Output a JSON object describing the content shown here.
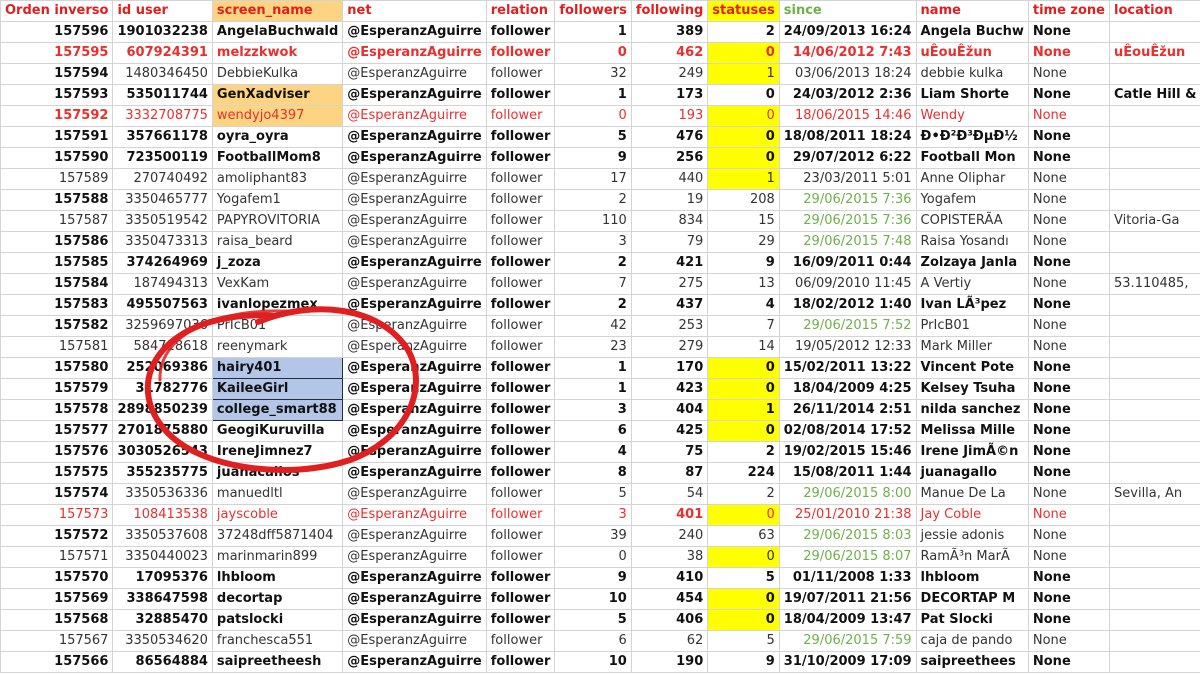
{
  "columns": [
    "Orden inverso",
    "id user",
    "screen_name",
    "net",
    "relation",
    "followers",
    "following",
    "statuses",
    "since",
    "name",
    "time zone",
    "location"
  ],
  "rows": [
    {
      "orden": "157596",
      "id": "1901032238",
      "screen": "AngelaBuchwald",
      "net": "@EsperanzAguirre",
      "rel": "follower",
      "followers": "1",
      "following": "389",
      "statuses": "2",
      "since": "24/09/2013 16:24",
      "name": "Angela Buchw",
      "tz": "None",
      "loc": "",
      "style": "bold"
    },
    {
      "orden": "157595",
      "id": "607924391",
      "screen": "melzzkwok",
      "net": "@EsperanzAguirre",
      "rel": "follower",
      "followers": "0",
      "following": "462",
      "statuses": "0",
      "since": "14/06/2012 7:43",
      "name": "uÊouÊžun",
      "tz": "None",
      "loc": "uÊouÊžun",
      "style": "redbold",
      "statusFill": "yellow"
    },
    {
      "orden": "157594",
      "id": "1480346450",
      "screen": "DebbieKulka",
      "net": "@EsperanzAguirre",
      "rel": "follower",
      "followers": "32",
      "following": "249",
      "statuses": "1",
      "since": "03/06/2013 18:24",
      "name": "debbie kulka",
      "tz": "None",
      "loc": "",
      "style": "normal",
      "statusFill": "yellow",
      "orderBold": true
    },
    {
      "orden": "157593",
      "id": "535011744",
      "screen": "GenXadviser",
      "net": "@EsperanzAguirre",
      "rel": "follower",
      "followers": "1",
      "following": "173",
      "statuses": "0",
      "since": "24/03/2012 2:36",
      "name": "Liam Shorte",
      "tz": "None",
      "loc": "Catle Hill &",
      "style": "bold",
      "screenFill": "orange"
    },
    {
      "orden": "157592",
      "id": "3332708775",
      "screen": "wendyjo4397",
      "net": "@EsperanzAguirre",
      "rel": "follower",
      "followers": "0",
      "following": "193",
      "statuses": "0",
      "since": "18/06/2015 14:46",
      "name": "Wendy",
      "tz": "None",
      "loc": "",
      "style": "red",
      "screenFill": "orange",
      "statusFill": "yellow",
      "orderBold": true
    },
    {
      "orden": "157591",
      "id": "357661178",
      "screen": "oyra_oyra",
      "net": "@EsperanzAguirre",
      "rel": "follower",
      "followers": "5",
      "following": "476",
      "statuses": "0",
      "since": "18/08/2011 18:24",
      "name": "Đ•Đ²Đ³ĐµĐ½",
      "tz": "None",
      "loc": "",
      "style": "bold",
      "statusFill": "yellow"
    },
    {
      "orden": "157590",
      "id": "723500119",
      "screen": "FootballMom8",
      "net": "@EsperanzAguirre",
      "rel": "follower",
      "followers": "9",
      "following": "256",
      "statuses": "0",
      "since": "29/07/2012 6:22",
      "name": "Football Mon",
      "tz": "None",
      "loc": "",
      "style": "bold",
      "statusFill": "yellow"
    },
    {
      "orden": "157589",
      "id": "270740492",
      "screen": "amoliphant83",
      "net": "@EsperanzAguirre",
      "rel": "follower",
      "followers": "17",
      "following": "440",
      "statuses": "1",
      "since": "23/03/2011 5:01",
      "name": "Anne Oliphar",
      "tz": "None",
      "loc": "",
      "style": "normal",
      "statusFill": "yellow"
    },
    {
      "orden": "157588",
      "id": "3350465777",
      "screen": "Yogafem1",
      "net": "@EsperanzAguirre",
      "rel": "follower",
      "followers": "2",
      "following": "19",
      "statuses": "208",
      "since": "29/06/2015 7:36",
      "name": "Yogafem",
      "tz": "None",
      "loc": "",
      "style": "normal",
      "sinceGreen": true,
      "orderBold": true
    },
    {
      "orden": "157587",
      "id": "3350519542",
      "screen": "PAPYROVITORIA",
      "net": "@EsperanzAguirre",
      "rel": "follower",
      "followers": "110",
      "following": "834",
      "statuses": "15",
      "since": "29/06/2015 7:36",
      "name": "COPISTERÃA",
      "tz": "None",
      "loc": "Vitoria-Ga",
      "style": "normal",
      "sinceGreen": true
    },
    {
      "orden": "157586",
      "id": "3350473313",
      "screen": "raisa_beard",
      "net": "@EsperanzAguirre",
      "rel": "follower",
      "followers": "3",
      "following": "79",
      "statuses": "29",
      "since": "29/06/2015 7:48",
      "name": "Raisa Yosandı",
      "tz": "None",
      "loc": "",
      "style": "normal",
      "sinceGreen": true,
      "orderBold": true
    },
    {
      "orden": "157585",
      "id": "374264969",
      "screen": "j_zoza",
      "net": "@EsperanzAguirre",
      "rel": "follower",
      "followers": "2",
      "following": "421",
      "statuses": "9",
      "since": "16/09/2011 0:44",
      "name": "Zolzaya Janla",
      "tz": "None",
      "loc": "",
      "style": "bold"
    },
    {
      "orden": "157584",
      "id": "187494313",
      "screen": "VexKam",
      "net": "@EsperanzAguirre",
      "rel": "follower",
      "followers": "7",
      "following": "275",
      "statuses": "13",
      "since": "06/09/2010 11:45",
      "name": "A Vertiy",
      "tz": "None",
      "loc": "53.110485,",
      "style": "normal",
      "orderBold": true
    },
    {
      "orden": "157583",
      "id": "495507563",
      "screen": "ivanlopezmex",
      "net": "@EsperanzAguirre",
      "rel": "follower",
      "followers": "2",
      "following": "437",
      "statuses": "4",
      "since": "18/02/2012 1:40",
      "name": "Ivan LÃ³pez",
      "tz": "None",
      "loc": "",
      "style": "bold"
    },
    {
      "orden": "157582",
      "id": "3259697036",
      "screen": "PrIcB01",
      "net": "@EsperanzAguirre",
      "rel": "follower",
      "followers": "42",
      "following": "253",
      "statuses": "7",
      "since": "29/06/2015 7:52",
      "name": "PrIcB01",
      "tz": "None",
      "loc": "",
      "style": "normal",
      "sinceGreen": true,
      "orderBold": true
    },
    {
      "orden": "157581",
      "id": "584718618",
      "screen": "reenymark",
      "net": "@EsperanzAguirre",
      "rel": "follower",
      "followers": "23",
      "following": "279",
      "statuses": "14",
      "since": "19/05/2012 12:33",
      "name": "Mark Miller",
      "tz": "None",
      "loc": "",
      "style": "normal"
    },
    {
      "orden": "157580",
      "id": "252069386",
      "screen": "hairy401",
      "net": "@EsperanzAguirre",
      "rel": "follower",
      "followers": "1",
      "following": "170",
      "statuses": "0",
      "since": "15/02/2011 13:22",
      "name": "Vincent Pote",
      "tz": "None",
      "loc": "",
      "style": "bold",
      "screenFill": "blue",
      "statusFill": "yellow"
    },
    {
      "orden": "157579",
      "id": "31782776",
      "screen": "KaileeGirl",
      "net": "@EsperanzAguirre",
      "rel": "follower",
      "followers": "1",
      "following": "423",
      "statuses": "0",
      "since": "18/04/2009 4:25",
      "name": "Kelsey Tsuha",
      "tz": "None",
      "loc": "",
      "style": "bold",
      "screenFill": "blue",
      "statusFill": "yellow"
    },
    {
      "orden": "157578",
      "id": "2898850239",
      "screen": "college_smart88",
      "net": "@EsperanzAguirre",
      "rel": "follower",
      "followers": "3",
      "following": "404",
      "statuses": "1",
      "since": "26/11/2014 2:51",
      "name": "nilda sanchez",
      "tz": "None",
      "loc": "",
      "style": "bold",
      "screenFill": "blue",
      "statusFill": "yellow"
    },
    {
      "orden": "157577",
      "id": "2701875880",
      "screen": "GeogiKuruvilla",
      "net": "@EsperanzAguirre",
      "rel": "follower",
      "followers": "6",
      "following": "425",
      "statuses": "0",
      "since": "02/08/2014 17:52",
      "name": "Melissa Mille",
      "tz": "None",
      "loc": "",
      "style": "bold",
      "statusFill": "yellow"
    },
    {
      "orden": "157576",
      "id": "3030526543",
      "screen": "IreneJimnez7",
      "net": "@EsperanzAguirre",
      "rel": "follower",
      "followers": "4",
      "following": "75",
      "statuses": "2",
      "since": "19/02/2015 15:46",
      "name": "Irene JimÃ©n",
      "tz": "None",
      "loc": "",
      "style": "bold"
    },
    {
      "orden": "157575",
      "id": "355235775",
      "screen": "juanacallos",
      "net": "@EsperanzAguirre",
      "rel": "follower",
      "followers": "8",
      "following": "87",
      "statuses": "224",
      "since": "15/08/2011 1:44",
      "name": "juanagallo",
      "tz": "None",
      "loc": "",
      "style": "bold"
    },
    {
      "orden": "157574",
      "id": "3350536336",
      "screen": "manuedltl",
      "net": "@EsperanzAguirre",
      "rel": "follower",
      "followers": "5",
      "following": "54",
      "statuses": "2",
      "since": "29/06/2015 8:00",
      "name": "Manue De La",
      "tz": "None",
      "loc": "Sevilla, An",
      "style": "normal",
      "sinceGreen": true,
      "orderBold": true
    },
    {
      "orden": "157573",
      "id": "108413538",
      "screen": "jayscoble",
      "net": "@EsperanzAguirre",
      "rel": "follower",
      "followers": "3",
      "following": "401",
      "statuses": "0",
      "since": "25/01/2010 21:38",
      "name": "Jay Coble",
      "tz": "None",
      "loc": "",
      "style": "red",
      "statusFill": "yellow",
      "followingBold": true
    },
    {
      "orden": "157572",
      "id": "3350537608",
      "screen": "37248dff5871404",
      "net": "@EsperanzAguirre",
      "rel": "follower",
      "followers": "39",
      "following": "240",
      "statuses": "63",
      "since": "29/06/2015 8:03",
      "name": "jessie adonis",
      "tz": "None",
      "loc": "",
      "style": "normal",
      "sinceGreen": true,
      "orderBold": true
    },
    {
      "orden": "157571",
      "id": "3350440023",
      "screen": "marinmarin899",
      "net": "@EsperanzAguirre",
      "rel": "follower",
      "followers": "0",
      "following": "38",
      "statuses": "0",
      "since": "29/06/2015 8:07",
      "name": "RamÃ³n MarÃ",
      "tz": "None",
      "loc": "",
      "style": "normal",
      "sinceGreen": true,
      "statusFill": "yellow"
    },
    {
      "orden": "157570",
      "id": "17095376",
      "screen": "lhbloom",
      "net": "@EsperanzAguirre",
      "rel": "follower",
      "followers": "9",
      "following": "410",
      "statuses": "5",
      "since": "01/11/2008 1:33",
      "name": "lhbloom",
      "tz": "None",
      "loc": "",
      "style": "bold"
    },
    {
      "orden": "157569",
      "id": "338647598",
      "screen": "decortap",
      "net": "@EsperanzAguirre",
      "rel": "follower",
      "followers": "10",
      "following": "454",
      "statuses": "0",
      "since": "19/07/2011 21:56",
      "name": "DECORTAP M",
      "tz": "None",
      "loc": "",
      "style": "bold",
      "statusFill": "yellow"
    },
    {
      "orden": "157568",
      "id": "32885470",
      "screen": "patslocki",
      "net": "@EsperanzAguirre",
      "rel": "follower",
      "followers": "5",
      "following": "406",
      "statuses": "0",
      "since": "18/04/2009 13:47",
      "name": "Pat Slocki",
      "tz": "None",
      "loc": "",
      "style": "bold",
      "statusFill": "yellow"
    },
    {
      "orden": "157567",
      "id": "3350534620",
      "screen": "franchesca551",
      "net": "@EsperanzAguirre",
      "rel": "follower",
      "followers": "6",
      "following": "62",
      "statuses": "5",
      "since": "29/06/2015 7:59",
      "name": "caja de pando",
      "tz": "None",
      "loc": "",
      "style": "normal",
      "sinceGreen": true
    },
    {
      "orden": "157566",
      "id": "86564884",
      "screen": "saipreetheesh",
      "net": "@EsperanzAguirre",
      "rel": "follower",
      "followers": "10",
      "following": "190",
      "statuses": "9",
      "since": "31/10/2009 17:09",
      "name": "saipreethees",
      "tz": "None",
      "loc": "",
      "style": "bold"
    }
  ]
}
